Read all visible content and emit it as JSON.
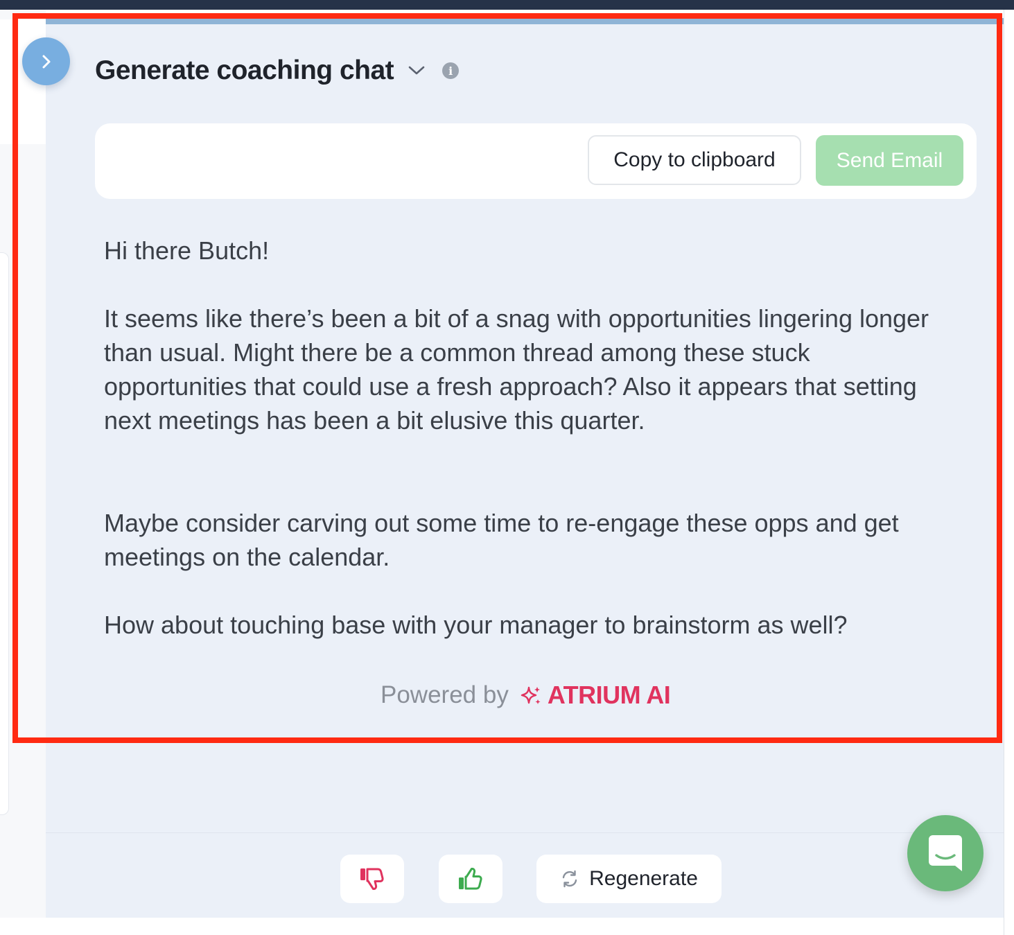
{
  "header": {
    "title": "Generate coaching chat"
  },
  "toolbar": {
    "copy_label": "Copy to clipboard",
    "send_label": "Send Email"
  },
  "message": {
    "greeting": "Hi there Butch!",
    "paragraph_1": "It seems like there’s been a bit of a snag with opportunities lingering longer than usual. Might there be a common thread among these stuck opportunities that could use a fresh approach? Also it appears that setting next meetings has been a bit elusive this quarter.",
    "paragraph_2": "Maybe consider carving out some time to re-engage these opps and get meetings on the calendar.",
    "paragraph_3": "How about touching base with your manager to brainstorm as well?"
  },
  "footer": {
    "powered_by": "Powered by",
    "brand": "ATRIUM AI"
  },
  "actions": {
    "regenerate_label": "Regenerate"
  },
  "icons": {
    "expand": "chevron-right-icon",
    "dropdown": "chevron-down-icon",
    "info": "info-icon",
    "sparkle": "sparkle-icon",
    "thumbs_down": "thumbs-down-icon",
    "thumbs_up": "thumbs-up-icon",
    "refresh": "refresh-icon",
    "chat": "chat-icon"
  },
  "colors": {
    "panel_bg": "#ebf0f8",
    "send_button": "#a6dfb0",
    "brand": "#e0335e",
    "thumbs_down": "#e0335e",
    "thumbs_up": "#3dab4f",
    "chat_fab": "#6ab97a",
    "highlight_border": "#ff2a12"
  }
}
